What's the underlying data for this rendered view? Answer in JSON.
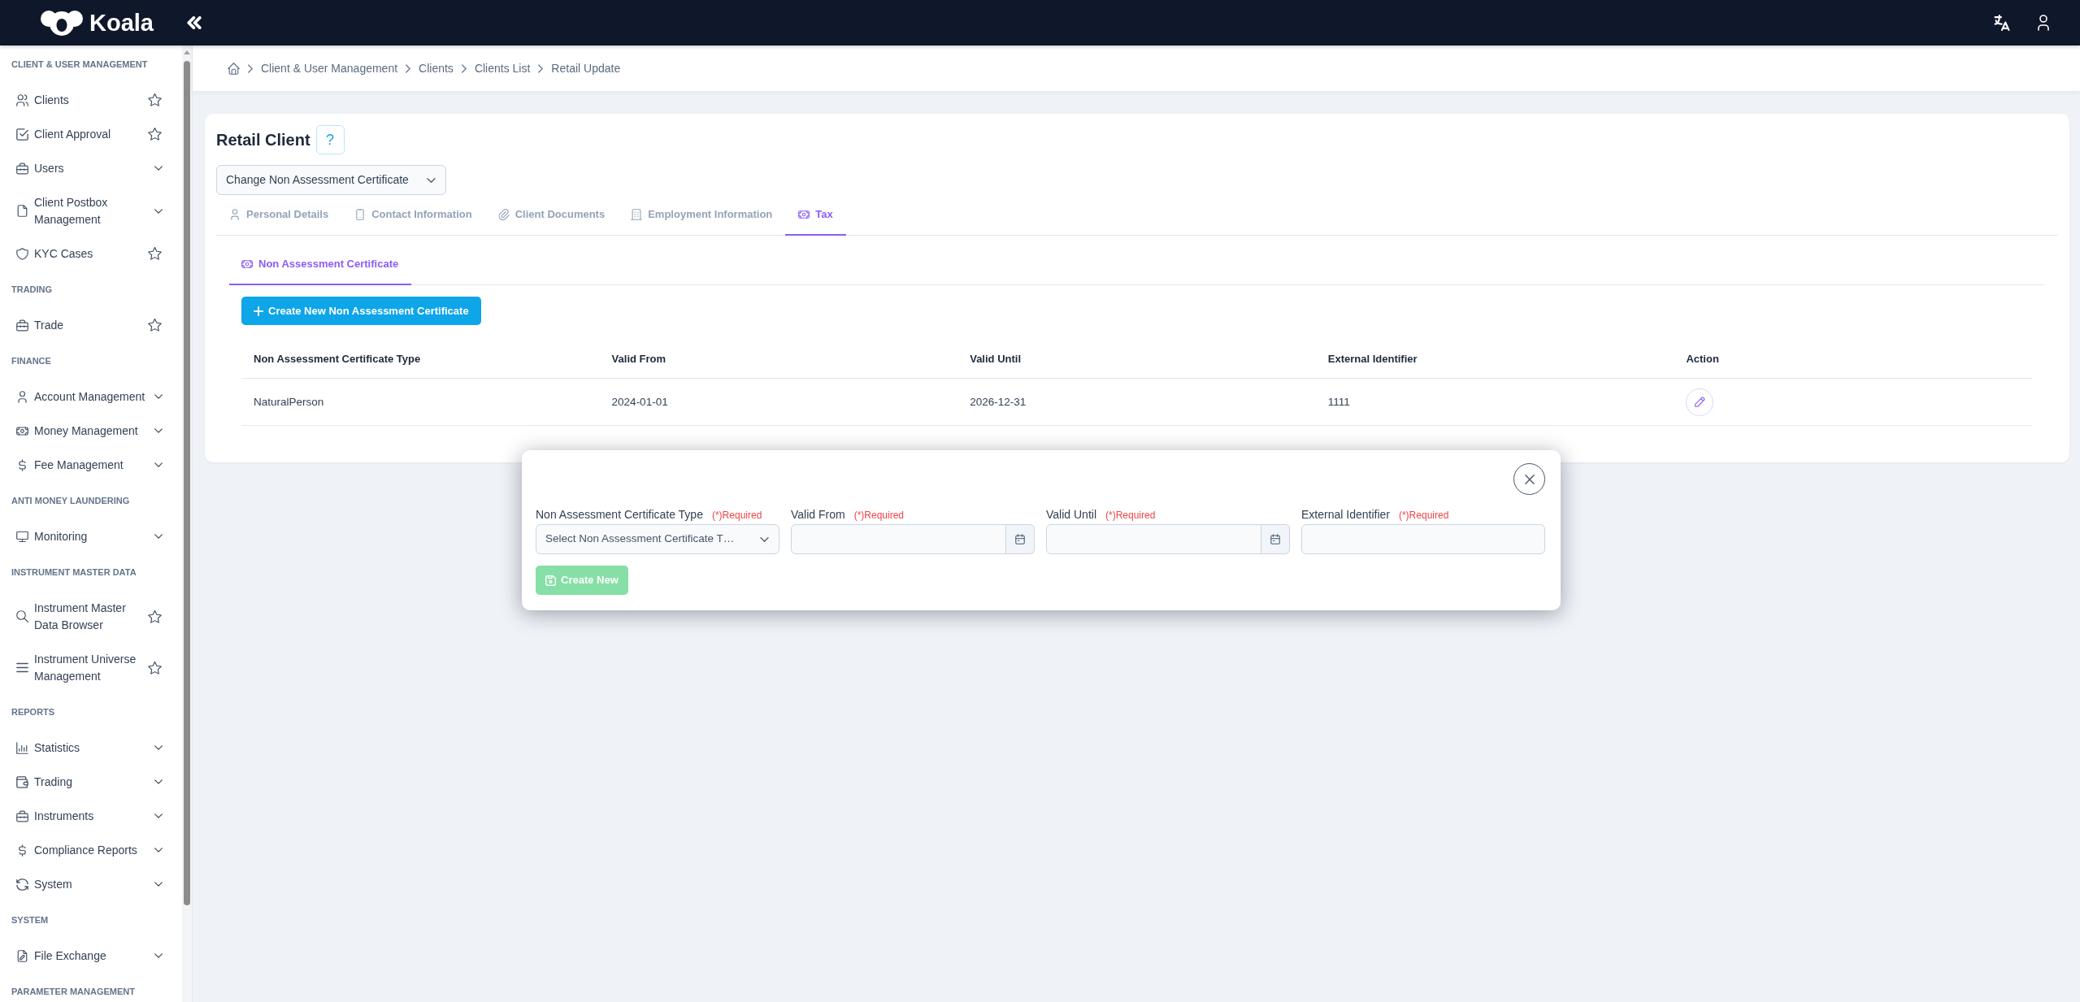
{
  "topbar": {
    "brand": "Koala"
  },
  "sidebar": {
    "sections": [
      {
        "title": "CLIENT & USER MANAGEMENT",
        "items": [
          {
            "label": "Clients",
            "kind": "favorite"
          },
          {
            "label": "Client Approval",
            "kind": "favorite"
          },
          {
            "label": "Users",
            "kind": "group"
          },
          {
            "label": "Client Postbox Management",
            "kind": "group"
          },
          {
            "label": "KYC Cases",
            "kind": "favorite"
          }
        ]
      },
      {
        "title": "TRADING",
        "items": [
          {
            "label": "Trade",
            "kind": "favorite"
          }
        ]
      },
      {
        "title": "FINANCE",
        "items": [
          {
            "label": "Account Management",
            "kind": "group"
          },
          {
            "label": "Money Management",
            "kind": "group"
          },
          {
            "label": "Fee Management",
            "kind": "group"
          }
        ]
      },
      {
        "title": "ANTI MONEY LAUNDERING",
        "items": [
          {
            "label": "Monitoring",
            "kind": "group"
          }
        ]
      },
      {
        "title": "INSTRUMENT MASTER DATA",
        "items": [
          {
            "label": "Instrument Master Data Browser",
            "kind": "favorite"
          },
          {
            "label": "Instrument Universe Management",
            "kind": "favorite"
          }
        ]
      },
      {
        "title": "REPORTS",
        "items": [
          {
            "label": "Statistics",
            "kind": "group"
          },
          {
            "label": "Trading",
            "kind": "group"
          },
          {
            "label": "Instruments",
            "kind": "group"
          },
          {
            "label": "Compliance Reports",
            "kind": "group"
          },
          {
            "label": "System",
            "kind": "group"
          }
        ]
      },
      {
        "title": "SYSTEM",
        "items": [
          {
            "label": "File Exchange",
            "kind": "group"
          }
        ]
      },
      {
        "title": "PARAMETER MANAGEMENT"
      }
    ]
  },
  "breadcrumb": [
    "Client & User Management",
    "Clients",
    "Clients List",
    "Retail Update"
  ],
  "page": {
    "title": "Retail Client",
    "help_button": "?",
    "action_select": {
      "value": "Change Non Assessment Certificate"
    },
    "tabs": [
      {
        "label": "Personal Details",
        "selected": false
      },
      {
        "label": "Contact Information",
        "selected": false
      },
      {
        "label": "Client Documents",
        "selected": false
      },
      {
        "label": "Employment Information",
        "selected": false
      },
      {
        "label": "Tax",
        "selected": true
      }
    ],
    "subtabs": [
      {
        "label": "Non Assessment Certificate",
        "selected": true
      }
    ],
    "create_button": "Create New Non Assessment Certificate",
    "table": {
      "columns": [
        "Non Assessment Certificate Type",
        "Valid From",
        "Valid Until",
        "External Identifier",
        "Action"
      ],
      "rows": [
        {
          "cells": [
            "NaturalPerson",
            "2024-01-01",
            "2026-12-31",
            "1111"
          ]
        }
      ]
    }
  },
  "modal": {
    "fields": [
      {
        "kind": "select",
        "label": "Non Assessment Certificate Type",
        "required_note": "(*)Required",
        "placeholder": "Select Non Assessment Certificate T…"
      },
      {
        "kind": "date",
        "label": "Valid From",
        "required_note": "(*)Required"
      },
      {
        "kind": "date",
        "label": "Valid Until",
        "required_note": "(*)Required"
      },
      {
        "kind": "text",
        "label": "External Identifier",
        "required_note": "(*)Required"
      }
    ],
    "submit_button": {
      "label": "Create New",
      "disabled": true
    }
  }
}
